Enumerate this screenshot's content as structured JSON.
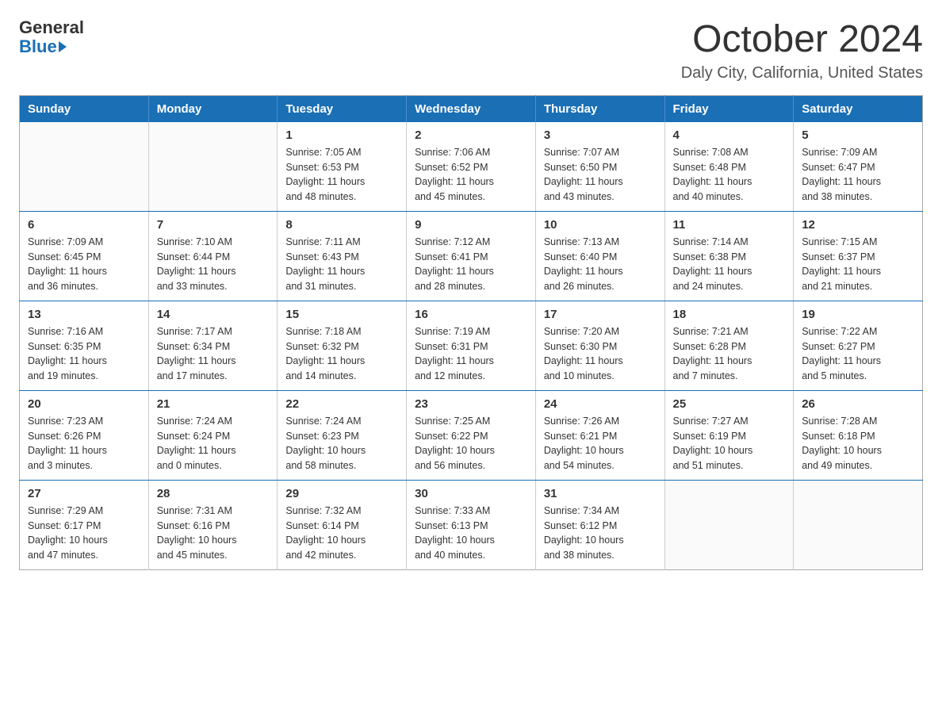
{
  "logo": {
    "general": "General",
    "blue": "Blue"
  },
  "title": "October 2024",
  "location": "Daly City, California, United States",
  "days_of_week": [
    "Sunday",
    "Monday",
    "Tuesday",
    "Wednesday",
    "Thursday",
    "Friday",
    "Saturday"
  ],
  "weeks": [
    [
      {
        "day": "",
        "info": ""
      },
      {
        "day": "",
        "info": ""
      },
      {
        "day": "1",
        "info": "Sunrise: 7:05 AM\nSunset: 6:53 PM\nDaylight: 11 hours\nand 48 minutes."
      },
      {
        "day": "2",
        "info": "Sunrise: 7:06 AM\nSunset: 6:52 PM\nDaylight: 11 hours\nand 45 minutes."
      },
      {
        "day": "3",
        "info": "Sunrise: 7:07 AM\nSunset: 6:50 PM\nDaylight: 11 hours\nand 43 minutes."
      },
      {
        "day": "4",
        "info": "Sunrise: 7:08 AM\nSunset: 6:48 PM\nDaylight: 11 hours\nand 40 minutes."
      },
      {
        "day": "5",
        "info": "Sunrise: 7:09 AM\nSunset: 6:47 PM\nDaylight: 11 hours\nand 38 minutes."
      }
    ],
    [
      {
        "day": "6",
        "info": "Sunrise: 7:09 AM\nSunset: 6:45 PM\nDaylight: 11 hours\nand 36 minutes."
      },
      {
        "day": "7",
        "info": "Sunrise: 7:10 AM\nSunset: 6:44 PM\nDaylight: 11 hours\nand 33 minutes."
      },
      {
        "day": "8",
        "info": "Sunrise: 7:11 AM\nSunset: 6:43 PM\nDaylight: 11 hours\nand 31 minutes."
      },
      {
        "day": "9",
        "info": "Sunrise: 7:12 AM\nSunset: 6:41 PM\nDaylight: 11 hours\nand 28 minutes."
      },
      {
        "day": "10",
        "info": "Sunrise: 7:13 AM\nSunset: 6:40 PM\nDaylight: 11 hours\nand 26 minutes."
      },
      {
        "day": "11",
        "info": "Sunrise: 7:14 AM\nSunset: 6:38 PM\nDaylight: 11 hours\nand 24 minutes."
      },
      {
        "day": "12",
        "info": "Sunrise: 7:15 AM\nSunset: 6:37 PM\nDaylight: 11 hours\nand 21 minutes."
      }
    ],
    [
      {
        "day": "13",
        "info": "Sunrise: 7:16 AM\nSunset: 6:35 PM\nDaylight: 11 hours\nand 19 minutes."
      },
      {
        "day": "14",
        "info": "Sunrise: 7:17 AM\nSunset: 6:34 PM\nDaylight: 11 hours\nand 17 minutes."
      },
      {
        "day": "15",
        "info": "Sunrise: 7:18 AM\nSunset: 6:32 PM\nDaylight: 11 hours\nand 14 minutes."
      },
      {
        "day": "16",
        "info": "Sunrise: 7:19 AM\nSunset: 6:31 PM\nDaylight: 11 hours\nand 12 minutes."
      },
      {
        "day": "17",
        "info": "Sunrise: 7:20 AM\nSunset: 6:30 PM\nDaylight: 11 hours\nand 10 minutes."
      },
      {
        "day": "18",
        "info": "Sunrise: 7:21 AM\nSunset: 6:28 PM\nDaylight: 11 hours\nand 7 minutes."
      },
      {
        "day": "19",
        "info": "Sunrise: 7:22 AM\nSunset: 6:27 PM\nDaylight: 11 hours\nand 5 minutes."
      }
    ],
    [
      {
        "day": "20",
        "info": "Sunrise: 7:23 AM\nSunset: 6:26 PM\nDaylight: 11 hours\nand 3 minutes."
      },
      {
        "day": "21",
        "info": "Sunrise: 7:24 AM\nSunset: 6:24 PM\nDaylight: 11 hours\nand 0 minutes."
      },
      {
        "day": "22",
        "info": "Sunrise: 7:24 AM\nSunset: 6:23 PM\nDaylight: 10 hours\nand 58 minutes."
      },
      {
        "day": "23",
        "info": "Sunrise: 7:25 AM\nSunset: 6:22 PM\nDaylight: 10 hours\nand 56 minutes."
      },
      {
        "day": "24",
        "info": "Sunrise: 7:26 AM\nSunset: 6:21 PM\nDaylight: 10 hours\nand 54 minutes."
      },
      {
        "day": "25",
        "info": "Sunrise: 7:27 AM\nSunset: 6:19 PM\nDaylight: 10 hours\nand 51 minutes."
      },
      {
        "day": "26",
        "info": "Sunrise: 7:28 AM\nSunset: 6:18 PM\nDaylight: 10 hours\nand 49 minutes."
      }
    ],
    [
      {
        "day": "27",
        "info": "Sunrise: 7:29 AM\nSunset: 6:17 PM\nDaylight: 10 hours\nand 47 minutes."
      },
      {
        "day": "28",
        "info": "Sunrise: 7:31 AM\nSunset: 6:16 PM\nDaylight: 10 hours\nand 45 minutes."
      },
      {
        "day": "29",
        "info": "Sunrise: 7:32 AM\nSunset: 6:14 PM\nDaylight: 10 hours\nand 42 minutes."
      },
      {
        "day": "30",
        "info": "Sunrise: 7:33 AM\nSunset: 6:13 PM\nDaylight: 10 hours\nand 40 minutes."
      },
      {
        "day": "31",
        "info": "Sunrise: 7:34 AM\nSunset: 6:12 PM\nDaylight: 10 hours\nand 38 minutes."
      },
      {
        "day": "",
        "info": ""
      },
      {
        "day": "",
        "info": ""
      }
    ]
  ]
}
